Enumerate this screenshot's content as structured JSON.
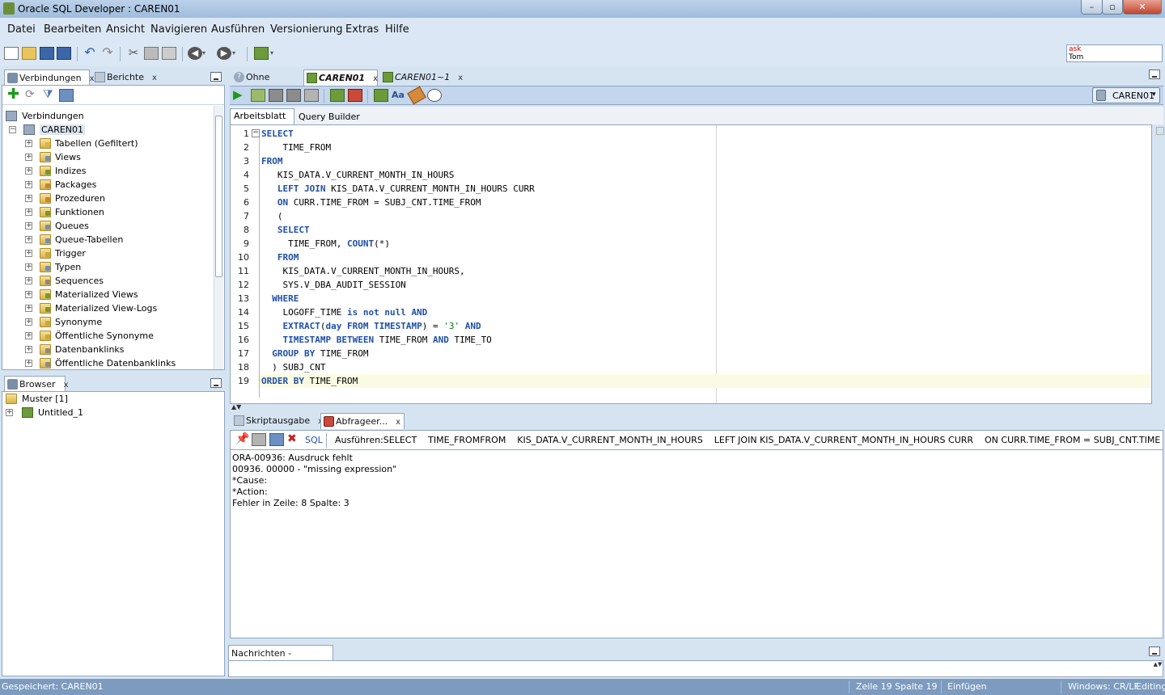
{
  "window": {
    "title": "Oracle SQL Developer : CAREN01"
  },
  "menu": [
    "Datei",
    "Bearbeiten",
    "Ansicht",
    "Navigieren",
    "Ausführen",
    "Versionierung",
    "Extras",
    "Hilfe"
  ],
  "ask_box": {
    "line1": "ask",
    "line2": "Tom"
  },
  "left_tabs": {
    "connections": "Verbindungen",
    "reports": "Berichte"
  },
  "tree": {
    "root": "Verbindungen",
    "connection": "CAREN01",
    "items": [
      "Tabellen (Gefiltert)",
      "Views",
      "Indizes",
      "Packages",
      "Prozeduren",
      "Funktionen",
      "Queues",
      "Queue-Tabellen",
      "Trigger",
      "Typen",
      "Sequences",
      "Materialized Views",
      "Materialized View-Logs",
      "Synonyme",
      "Öffentliche Synonyme",
      "Datenbanklinks",
      "Öffentliche Datenbanklinks"
    ]
  },
  "browser": {
    "tab": "Browser",
    "items": [
      "Muster [1]",
      "Untitled_1"
    ]
  },
  "editor_tabs": [
    "Ohne Titel",
    "CAREN01",
    "CAREN01~1"
  ],
  "connection_selector": "CAREN01",
  "sub_tabs": {
    "worksheet": "Arbeitsblatt",
    "query_builder": "Query Builder"
  },
  "code_lines": [
    [
      [
        "kw",
        "SELECT"
      ]
    ],
    [
      [
        "t",
        "    TIME_FROM"
      ]
    ],
    [
      [
        "kw",
        "FROM"
      ]
    ],
    [
      [
        "t",
        "   KIS_DATA.V_CURRENT_MONTH_IN_HOURS"
      ]
    ],
    [
      [
        "t",
        "   "
      ],
      [
        "kw",
        "LEFT JOIN"
      ],
      [
        "t",
        " KIS_DATA.V_CURRENT_MONTH_IN_HOURS CURR"
      ]
    ],
    [
      [
        "t",
        "   "
      ],
      [
        "kw",
        "ON"
      ],
      [
        "t",
        " CURR.TIME_FROM = SUBJ_CNT.TIME_FROM"
      ]
    ],
    [
      [
        "t",
        "   ("
      ]
    ],
    [
      [
        "t",
        "   "
      ],
      [
        "kw",
        "SELECT"
      ]
    ],
    [
      [
        "t",
        "     TIME_FROM, "
      ],
      [
        "kw",
        "COUNT"
      ],
      [
        "t",
        "(*)"
      ]
    ],
    [
      [
        "t",
        "   "
      ],
      [
        "kw",
        "FROM"
      ]
    ],
    [
      [
        "t",
        "    KIS_DATA.V_CURRENT_MONTH_IN_HOURS,"
      ]
    ],
    [
      [
        "t",
        "    SYS.V_DBA_AUDIT_SESSION"
      ]
    ],
    [
      [
        "t",
        "  "
      ],
      [
        "kw",
        "WHERE"
      ]
    ],
    [
      [
        "t",
        "    LOGOFF_TIME "
      ],
      [
        "kw",
        "is not null AND"
      ]
    ],
    [
      [
        "t",
        "    "
      ],
      [
        "kw",
        "EXTRACT"
      ],
      [
        "t",
        "("
      ],
      [
        "kw",
        "day FROM TIMESTAMP"
      ],
      [
        "t",
        ") = "
      ],
      [
        "str",
        "'3'"
      ],
      [
        "t",
        " "
      ],
      [
        "kw",
        "AND"
      ]
    ],
    [
      [
        "t",
        "    "
      ],
      [
        "kw",
        "TIMESTAMP BETWEEN"
      ],
      [
        "t",
        " TIME_FROM "
      ],
      [
        "kw",
        "AND"
      ],
      [
        "t",
        " TIME_TO"
      ]
    ],
    [
      [
        "t",
        "  "
      ],
      [
        "kw",
        "GROUP BY"
      ],
      [
        "t",
        " TIME_FROM"
      ]
    ],
    [
      [
        "t",
        "  ) SUBJ_CNT"
      ]
    ],
    [
      [
        "kw",
        "ORDER BY"
      ],
      [
        "t",
        " TIME_FROM"
      ]
    ]
  ],
  "output_tabs": {
    "script": "Skriptausgabe",
    "query": "Abfrageer..."
  },
  "output_toolbar": {
    "sql_label": "SQL",
    "run_text": "Ausführen:SELECT    TIME_FROMFROM    KIS_DATA.V_CURRENT_MONTH_IN_HOURS    LEFT JOIN KIS_DATA.V_CURRENT_MONTH_IN_HOURS CURR    ON CURR.TIME_FROM = SUBJ_CNT.TIME_FROM    (    SELE..."
  },
  "output_lines": [
    "ORA-00936: Ausdruck fehlt",
    "00936. 00000 -  \"missing expression\"",
    "*Cause:",
    "*Action:",
    "Fehler in Zeile: 8 Spalte: 3"
  ],
  "messages_tab": "Nachrichten - Protokoll",
  "status": {
    "saved": "Gespeichert: CAREN01",
    "position": "Zeile 19 Spalte 19",
    "mode": "Einfügen",
    "encoding": "Windows: CR/LF",
    "editing": "Editing"
  }
}
